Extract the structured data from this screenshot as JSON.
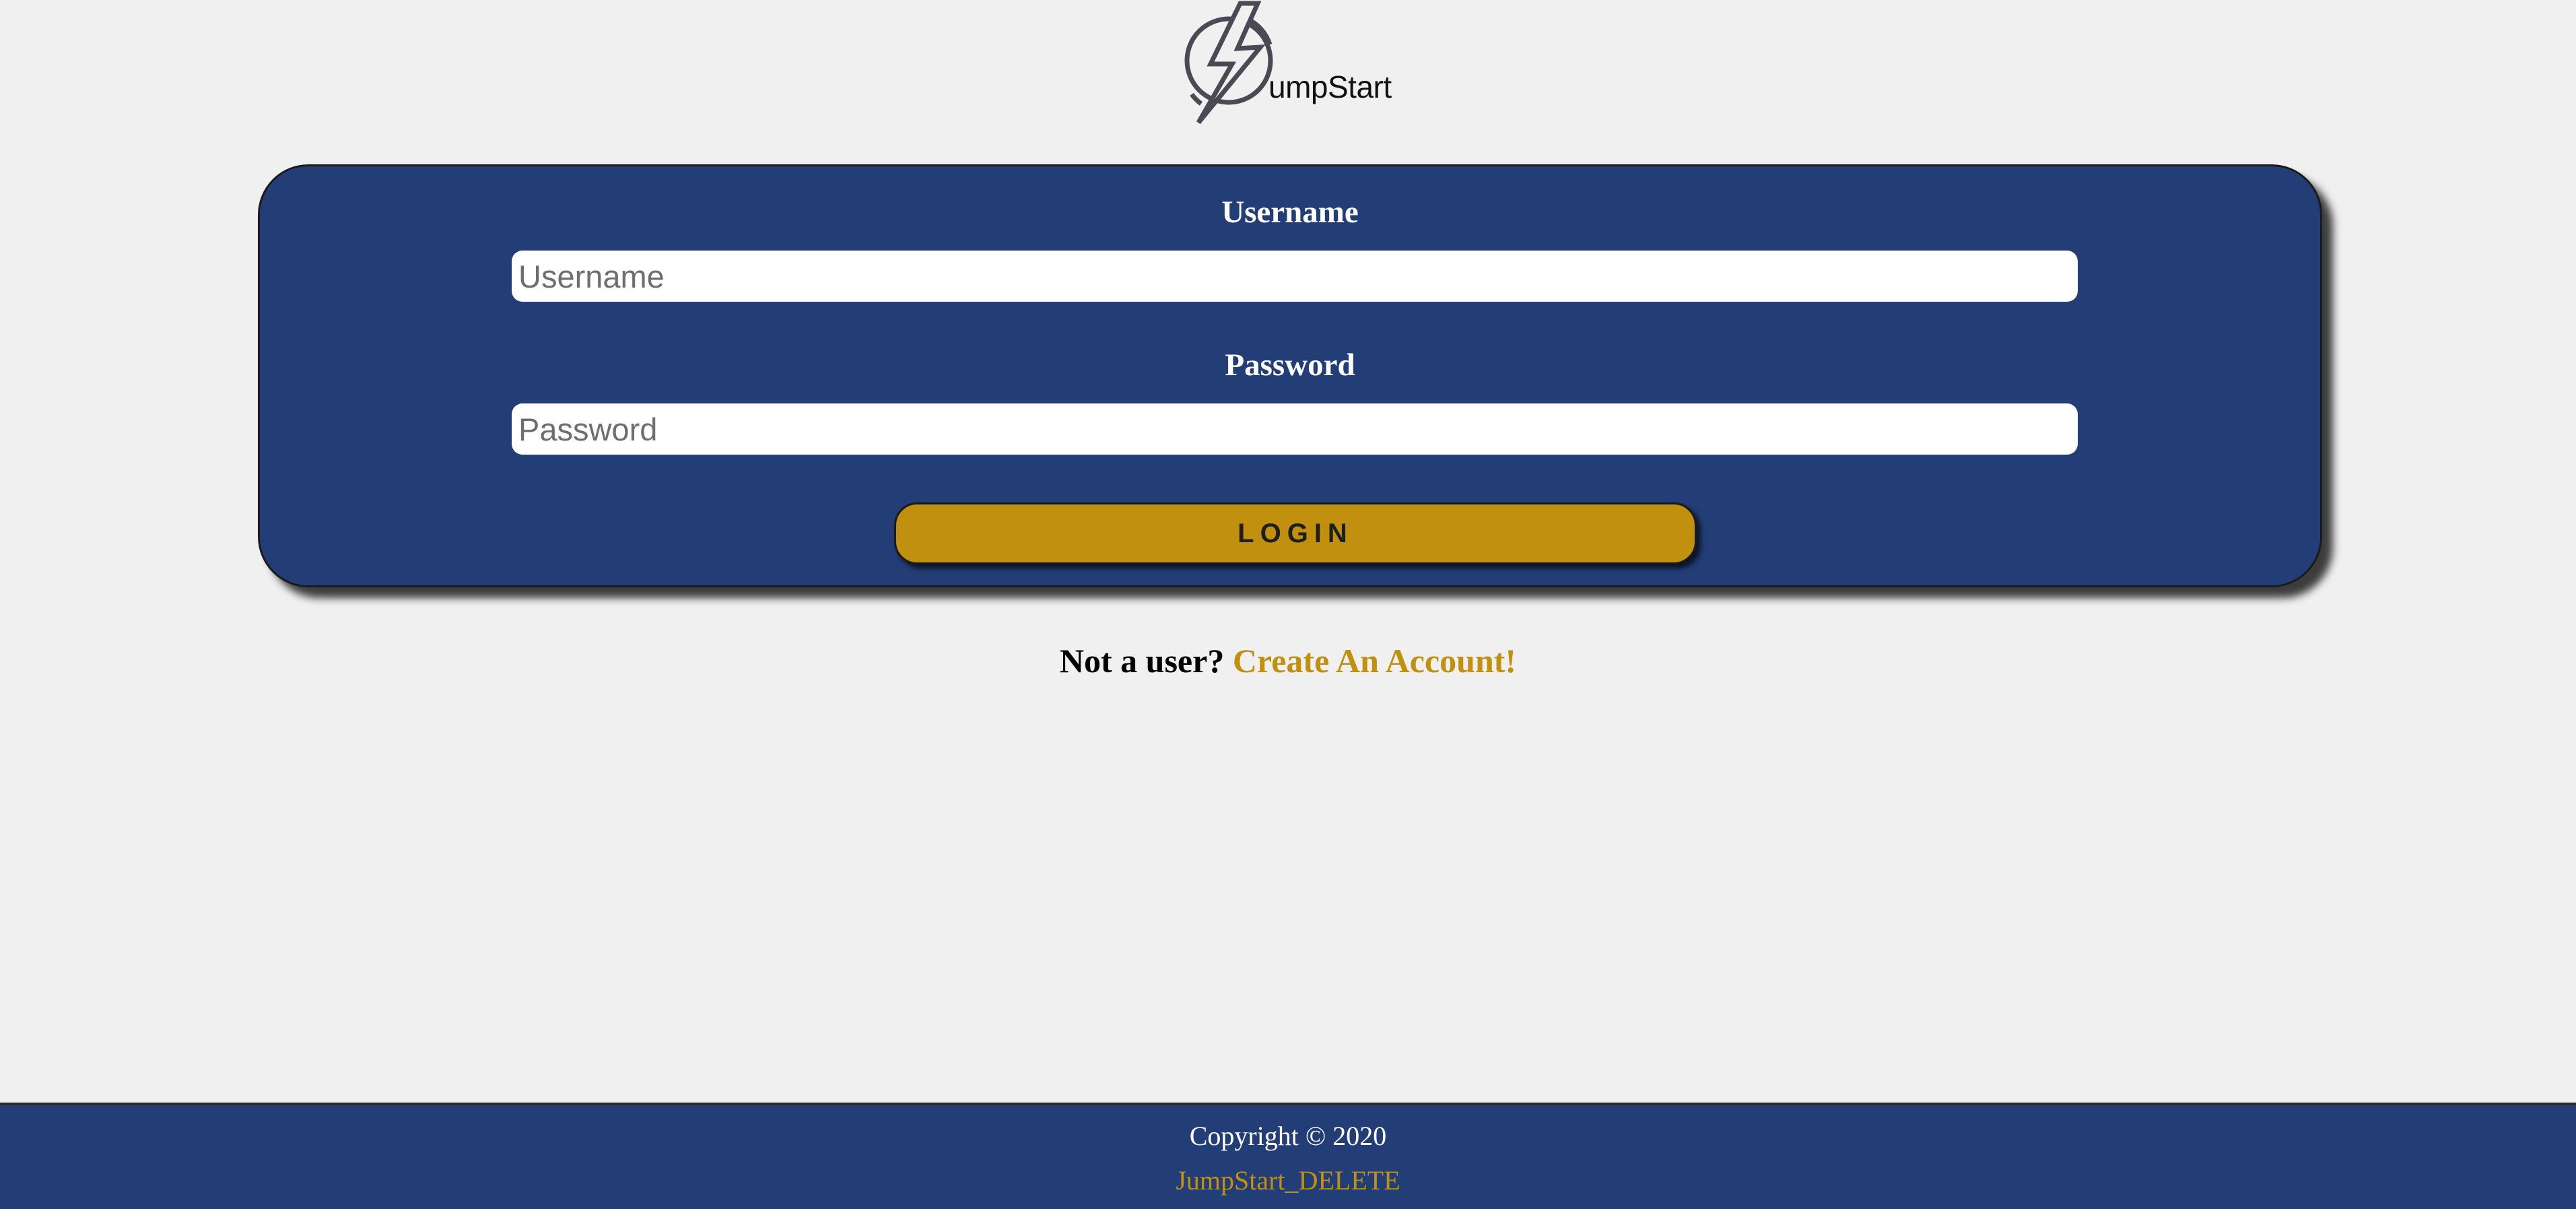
{
  "brand": {
    "logo_text": "umpStart",
    "logo_icon": "lightning-bolt-icon"
  },
  "login_form": {
    "username_label": "Username",
    "username_placeholder": "Username",
    "username_value": "",
    "password_label": "Password",
    "password_placeholder": "Password",
    "password_value": "",
    "login_button_label": "LOGIN"
  },
  "signup": {
    "prompt": "Not a user?",
    "link_label": "Create An Account!"
  },
  "footer": {
    "copyright": "Copyright © 2020",
    "link_label": "JumpStart_DELETE"
  },
  "colors": {
    "background": "#f0f0f0",
    "primary_navy": "#233e77",
    "accent_gold": "#c0900e"
  }
}
